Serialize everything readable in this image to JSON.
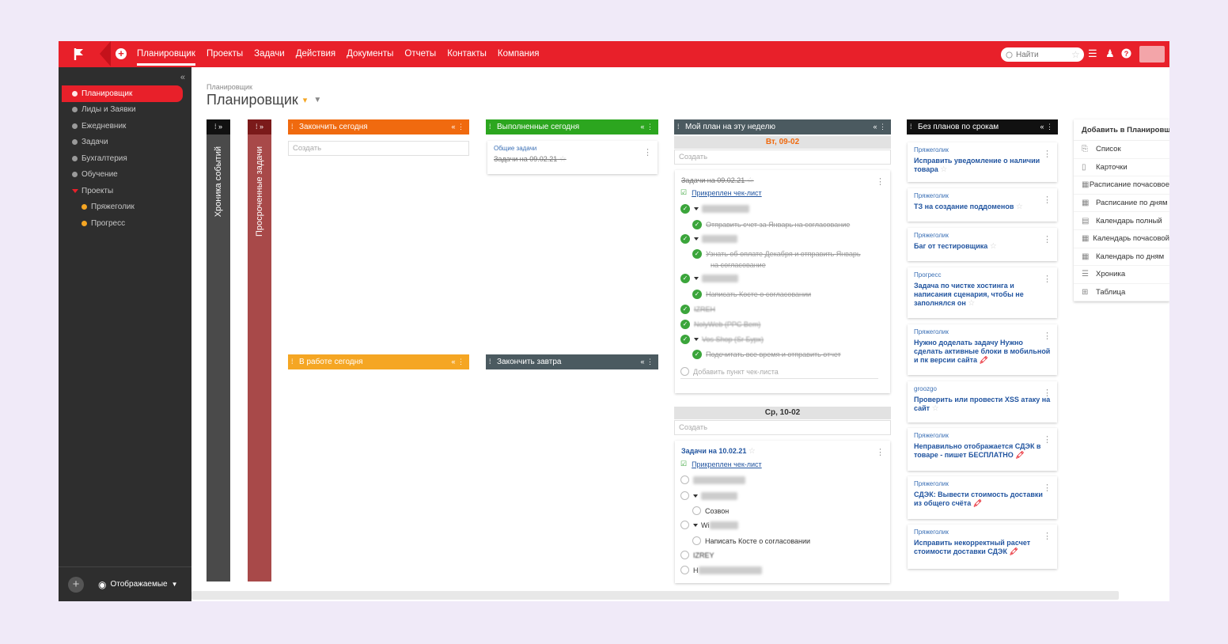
{
  "topbar": {
    "nav": [
      "Планировщик",
      "Проекты",
      "Задачи",
      "Действия",
      "Документы",
      "Отчеты",
      "Контакты",
      "Компания"
    ],
    "search_placeholder": "Найти"
  },
  "sidebar": {
    "items": [
      {
        "label": "Планировщик",
        "active": true
      },
      {
        "label": "Лиды и Заявки"
      },
      {
        "label": "Ежедневник"
      },
      {
        "label": "Задачи"
      },
      {
        "label": "Бухгалтерия"
      },
      {
        "label": "Обучение"
      },
      {
        "label": "Проекты"
      },
      {
        "label": "Пряжеголик"
      },
      {
        "label": "Прогресс"
      }
    ],
    "bottom_label": "Отображаемые"
  },
  "page": {
    "breadcrumb": "Планировщик",
    "title": "Планировщик"
  },
  "bars": {
    "chronicle": "Хроника событий",
    "overdue": "Просроченные задачи"
  },
  "columns": {
    "today": "Закончить сегодня",
    "done": "Выполненные сегодня",
    "in_work": "В работе сегодня",
    "tomorrow": "Закончить завтра",
    "week": "Мой план на эту неделю",
    "no_plan": "Без планов по срокам"
  },
  "create_label": "Создать",
  "done_card": {
    "project": "Общие задачи",
    "title": "Задачи на 09.02.21"
  },
  "week": {
    "day1": "Вт, 09-02",
    "day2": "Ср, 10-02",
    "card1": {
      "title": "Задачи на 09.02.21",
      "attached": "Прикреплен чек-лист",
      "rows": [
        "Отправить счет за Январь на согласование",
        "Узнать об оплате Декабря и отправить Январь",
        "на согласование",
        "Написать Косте о согласовании",
        "IZREH",
        "NolyWeb (PPC Bem)",
        "Vos Shop (Sr Бурх)",
        "Подсчитать все время и отправить отчет"
      ],
      "add": "Добавить пункт чек-листа"
    },
    "card2": {
      "title": "Задачи на 10.02.21",
      "attached": "Прикреплен чек-лист",
      "rows": [
        "Созвон",
        "Wi",
        "Написать Косте о согласовании",
        "IZREY",
        "H"
      ]
    }
  },
  "noplan_cards": [
    {
      "project": "Пряжеголик",
      "title": "Исправить уведомление о наличии товара",
      "mark": "star"
    },
    {
      "project": "Пряжеголик",
      "title": "ТЗ на создание поддоменов",
      "mark": "star"
    },
    {
      "project": "Пряжеголик",
      "title": "Баг от тестировщика",
      "mark": "star"
    },
    {
      "project": "Прогресс",
      "title": "Задача по чистке хостинга и написания сценария, чтобы не заполнялся он",
      "mark": "star"
    },
    {
      "project": "Пряжеголик",
      "title": "Нужно доделать задачу Нужно сделать активные блоки в мобильной и пк версии сайта",
      "mark": "fire"
    },
    {
      "project": "groozgo",
      "title": "Проверить или провести XSS атаку на сайт",
      "mark": "star"
    },
    {
      "project": "Пряжеголик",
      "title": "Неправильно отображается СДЭК в товаре - пишет БЕСПЛАТНО",
      "mark": "fire"
    },
    {
      "project": "Пряжеголик",
      "title": "СДЭК: Вывести стоимость доставки из общего счёта",
      "mark": "fire"
    },
    {
      "project": "Пряжеголик",
      "title": "Исправить некорректный расчет стоимости доставки СДЭК",
      "mark": "fire"
    }
  ],
  "add_panel": {
    "title": "Добавить в Планировщик",
    "items": [
      "Список",
      "Карточки",
      "Расписание почасовое",
      "Расписание по дням",
      "Календарь полный",
      "Календарь почасовой",
      "Календарь по дням",
      "Хроника",
      "Таблица"
    ]
  },
  "colors": {
    "brand": "#e8202a",
    "orange": "#f06a0f",
    "green": "#2ca61f",
    "amber": "#f5a623",
    "slate": "#4b5a60",
    "overdue": "#a84949"
  }
}
